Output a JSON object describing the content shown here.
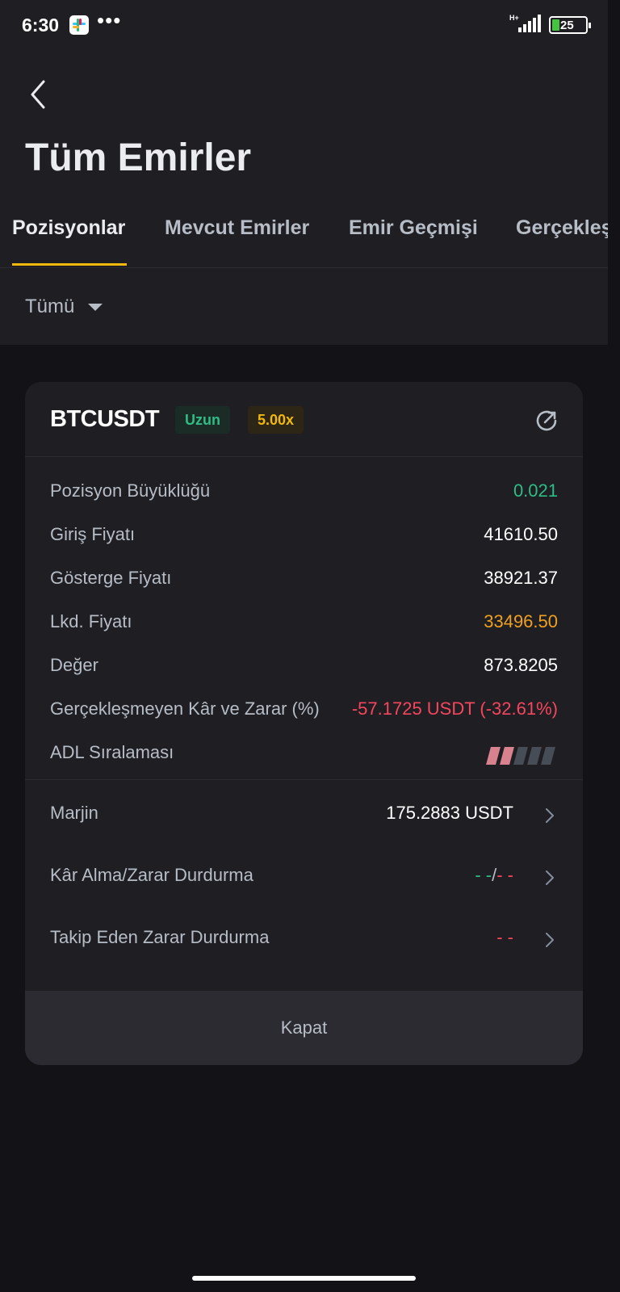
{
  "status_bar": {
    "time": "6:30",
    "network": "H+",
    "battery": "25",
    "icons": [
      "slack-icon",
      "more-dots-icon",
      "signal-icon",
      "battery-icon"
    ]
  },
  "header": {
    "title": "Tüm Emirler",
    "back_icon": "back-icon"
  },
  "tabs": [
    {
      "label": "Pozisyonlar",
      "active": true
    },
    {
      "label": "Mevcut Emirler",
      "active": false
    },
    {
      "label": "Emir Geçmişi",
      "active": false
    },
    {
      "label": "Gerçekleş",
      "active": false
    }
  ],
  "filter": {
    "label": "Tümü"
  },
  "position": {
    "symbol": "BTCUSDT",
    "side": "Uzun",
    "leverage": "5.00x",
    "share_icon": "share-icon",
    "rows": [
      {
        "label": "Pozisyon Büyüklüğü",
        "value": "0.021",
        "color": "#2ebd85"
      },
      {
        "label": "Giriş Fiyatı",
        "value": "41610.50",
        "color": "#ffffff"
      },
      {
        "label": "Gösterge Fiyatı",
        "value": "38921.37",
        "color": "#ffffff"
      },
      {
        "label": "Lkd. Fiyatı",
        "value": "33496.50",
        "color": "#f0a020"
      },
      {
        "label": "Değer",
        "value": "873.8205",
        "color": "#ffffff"
      },
      {
        "label": "Gerçekleşmeyen Kâr ve Zarar (%)",
        "value": "-57.1725 USDT (-32.61%)",
        "color": "#f6465d"
      },
      {
        "label": "ADL Sıralaması",
        "adl_level": 2,
        "adl_max": 5
      }
    ],
    "links": [
      {
        "label": "Marjin",
        "value": "175.2883 USDT"
      },
      {
        "label": "Kâr Alma/Zarar Durdurma",
        "value_tp": "- -",
        "value_sep": "/",
        "value_sl": "- -"
      },
      {
        "label": "Takip Eden Zarar Durdurma",
        "value": "- -"
      }
    ],
    "close_label": "Kapat"
  },
  "colors": {
    "background": "#121217",
    "panel": "#1e1e23",
    "accent": "#f0b90b",
    "positive": "#2ebd85",
    "negative": "#f6465d"
  }
}
